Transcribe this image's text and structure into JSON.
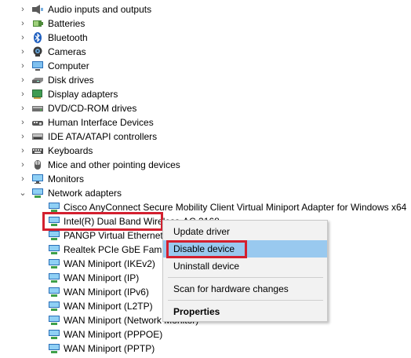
{
  "categories": [
    {
      "label": "Audio inputs and outputs",
      "icon": "speaker-icon"
    },
    {
      "label": "Batteries",
      "icon": "battery-icon"
    },
    {
      "label": "Bluetooth",
      "icon": "bluetooth-icon"
    },
    {
      "label": "Cameras",
      "icon": "camera-icon"
    },
    {
      "label": "Computer",
      "icon": "computer-icon"
    },
    {
      "label": "Disk drives",
      "icon": "disk-drive-icon"
    },
    {
      "label": "Display adapters",
      "icon": "display-adapter-icon"
    },
    {
      "label": "DVD/CD-ROM drives",
      "icon": "dvd-drive-icon"
    },
    {
      "label": "Human Interface Devices",
      "icon": "hid-icon"
    },
    {
      "label": "IDE ATA/ATAPI controllers",
      "icon": "ide-controller-icon"
    },
    {
      "label": "Keyboards",
      "icon": "keyboard-icon"
    },
    {
      "label": "Mice and other pointing devices",
      "icon": "mouse-icon"
    },
    {
      "label": "Monitors",
      "icon": "monitor-icon"
    },
    {
      "label": "Network adapters",
      "icon": "network-adapter-icon",
      "expanded": true
    }
  ],
  "network_adapters": [
    "Cisco AnyConnect Secure Mobility Client Virtual Miniport Adapter for Windows x64",
    "Intel(R) Dual Band Wireless-AC 3168",
    "PANGP Virtual Ethernet Adapter",
    "Realtek PCIe GbE Family Controller",
    "WAN Miniport (IKEv2)",
    "WAN Miniport (IP)",
    "WAN Miniport (IPv6)",
    "WAN Miniport (L2TP)",
    "WAN Miniport (Network Monitor)",
    "WAN Miniport (PPPOE)",
    "WAN Miniport (PPTP)"
  ],
  "context_menu": {
    "update_driver": "Update driver",
    "disable_device": "Disable device",
    "uninstall_device": "Uninstall device",
    "scan_hardware": "Scan for hardware changes",
    "properties": "Properties"
  },
  "colors": {
    "highlight_border": "#d3202f",
    "menu_selection": "#99c9ef",
    "menu_background": "#f2f2f2"
  }
}
